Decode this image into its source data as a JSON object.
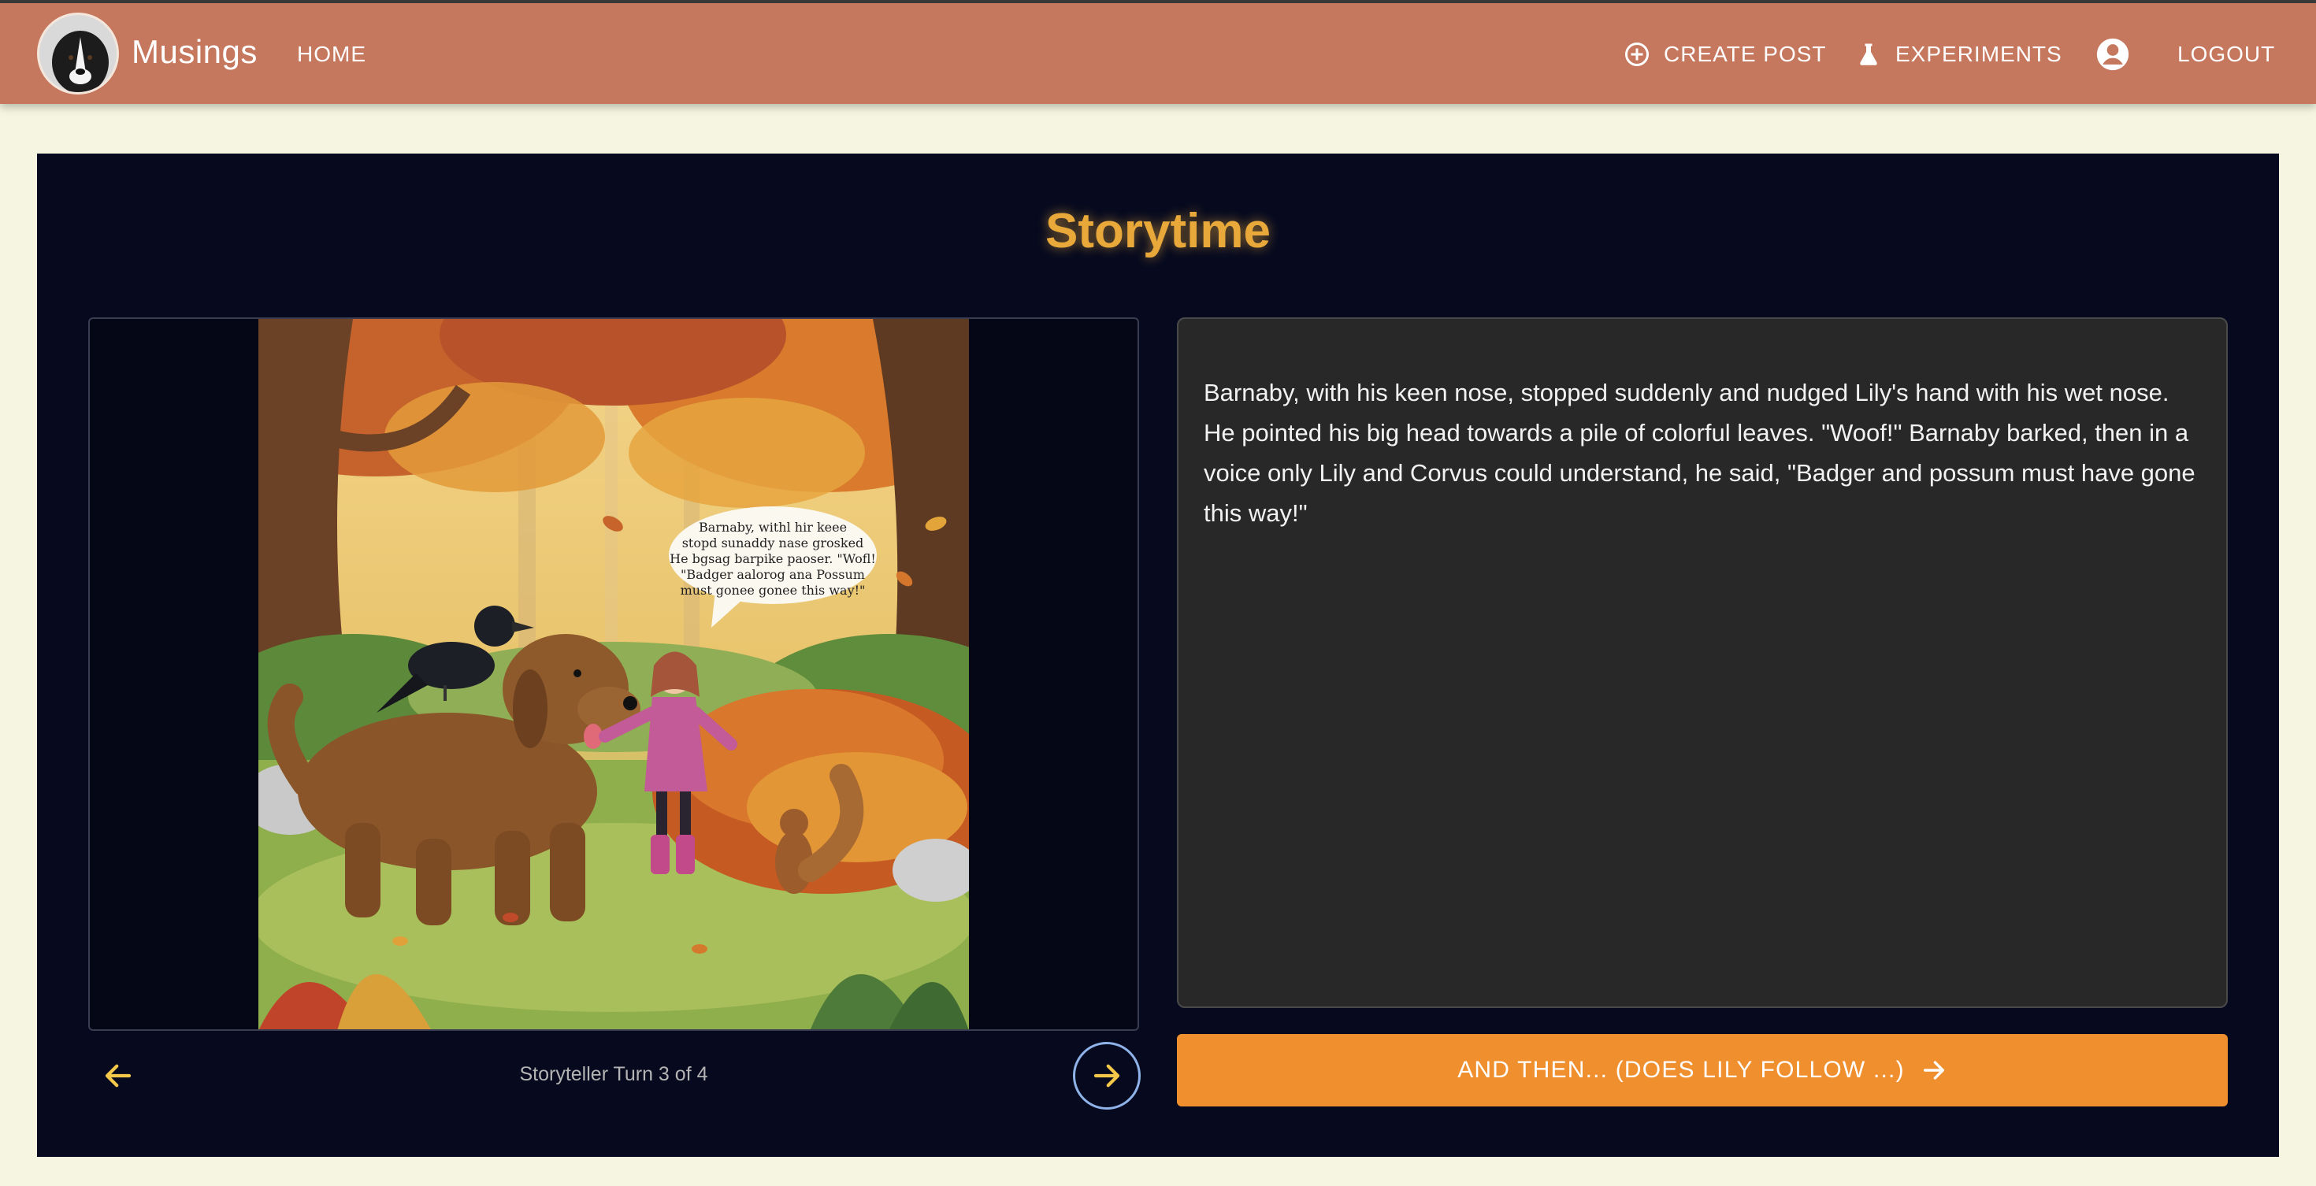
{
  "appbar": {
    "brand": "Musings",
    "nav": {
      "home": "HOME",
      "create_post": "CREATE POST",
      "experiments": "EXPERIMENTS",
      "logout": "LOGOUT"
    },
    "icons": {
      "create_post": "add-circle-icon",
      "experiments": "flask-icon",
      "account": "account-circle-icon"
    }
  },
  "main": {
    "title": "Storytime",
    "story_text": "Barnaby, with his keen nose, stopped suddenly and nudged Lily's hand with his wet nose. He pointed his big head towards a pile of colorful leaves. \"Woof!\" Barnaby barked, then in a voice only Lily and Corvus could understand, he said, \"Badger and possum must have gone this way!\"",
    "illustration": {
      "speech_bubble_lines": [
        "Barnaby, withl hir keee",
        "stopd sunaddy nase grosked",
        "He bgsag barpike paoser. \"Wofl!",
        "\"Badger aalorog ana Possum",
        "must gonee gonee this way!\""
      ]
    },
    "pager": {
      "turn_label": "Storyteller Turn 3 of 4",
      "prev_icon": "arrow-left-icon",
      "next_icon": "arrow-right-icon"
    },
    "continue_button": "AND THEN... (DOES LILY FOLLOW ...)"
  },
  "colors": {
    "appbar": "#c5785e",
    "page_background": "#f5f5e1",
    "panel": "#070a1f",
    "title": "#e8a93a",
    "accent_button": "#f08f2e",
    "arrow_accent": "#f5c84a"
  }
}
